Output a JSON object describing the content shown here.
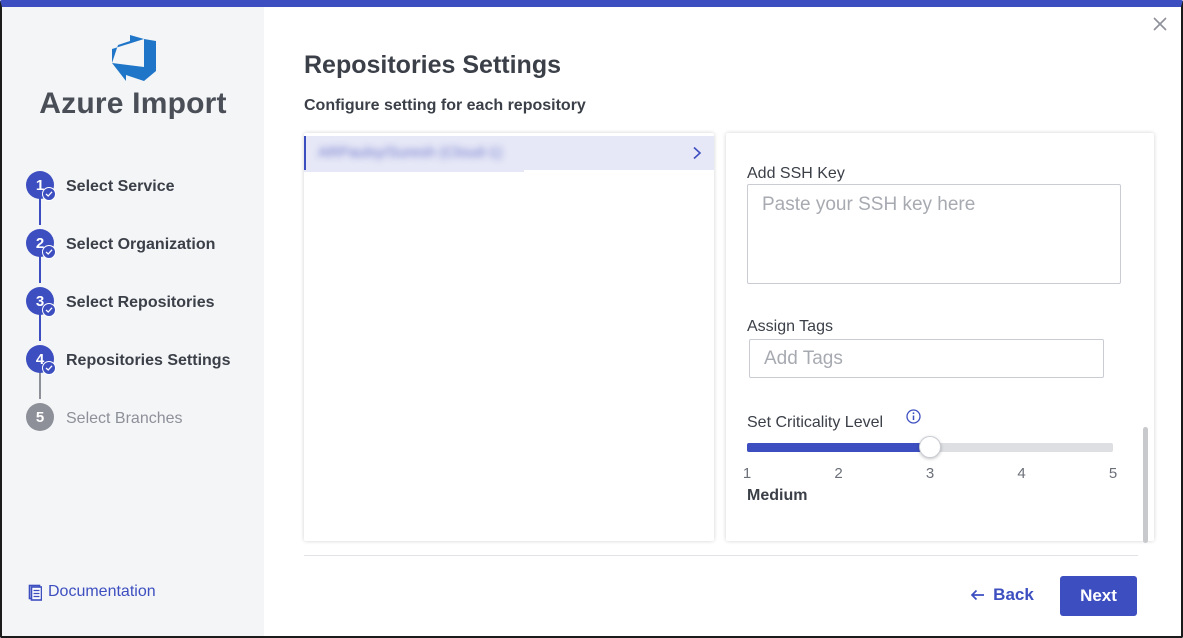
{
  "sidebar": {
    "app_title": "Azure Import",
    "steps": [
      {
        "number": "1",
        "label": "Select Service",
        "state": "completed"
      },
      {
        "number": "2",
        "label": "Select Organization",
        "state": "completed"
      },
      {
        "number": "3",
        "label": "Select Repositories",
        "state": "completed"
      },
      {
        "number": "4",
        "label": "Repositories Settings",
        "state": "current"
      },
      {
        "number": "5",
        "label": "Select Branches",
        "state": "pending"
      }
    ],
    "documentation_label": "Documentation"
  },
  "main": {
    "title": "Repositories Settings",
    "subtitle": "Configure setting for each repository",
    "repositories": [
      {
        "name": "ARPaulsy/Suresh (Cloud-1)",
        "selected": true,
        "blurred": true
      }
    ],
    "settings": {
      "ssh_label": "Add SSH Key",
      "ssh_placeholder": "Paste your SSH key here",
      "tags_label": "Assign Tags",
      "tags_placeholder": "Add Tags",
      "criticality_label": "Set Criticality Level",
      "criticality": {
        "min": 1,
        "max": 5,
        "value": 3,
        "ticks": [
          "1",
          "2",
          "3",
          "4",
          "5"
        ],
        "value_label": "Medium"
      }
    }
  },
  "footer": {
    "back_label": "Back",
    "next_label": "Next"
  },
  "colors": {
    "accent": "#3d4fc0",
    "sidebar_bg": "#f4f5f7",
    "pending": "#8d9099",
    "selected_row": "#e6e8f7"
  }
}
